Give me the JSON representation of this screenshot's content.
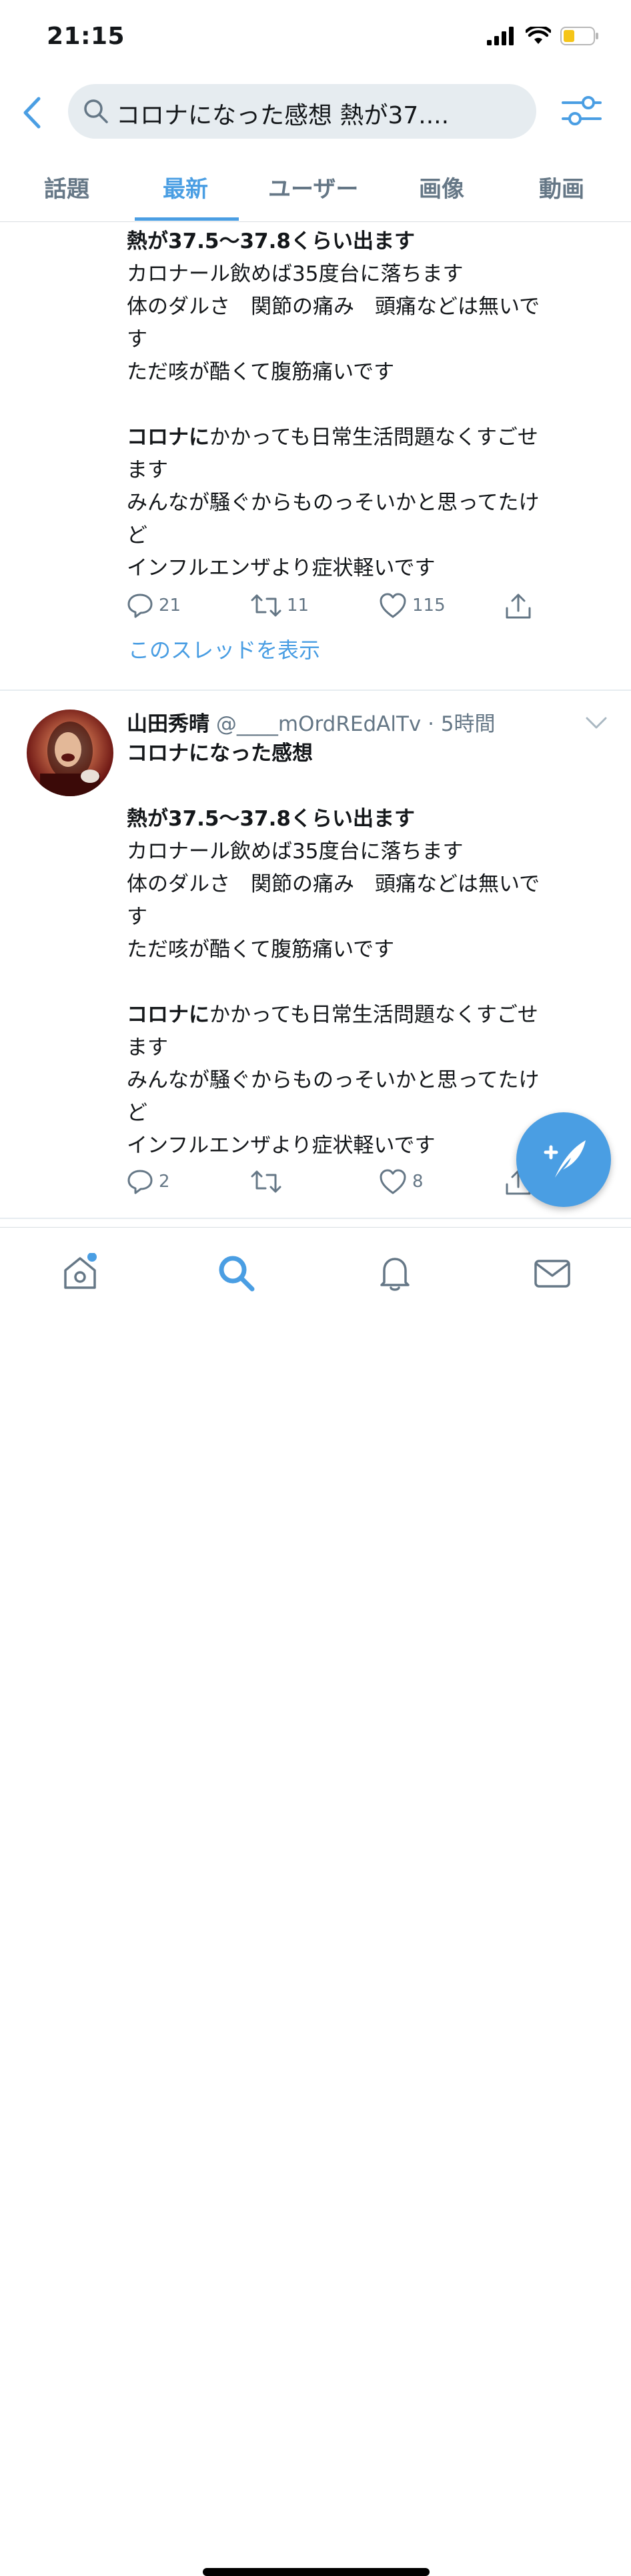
{
  "status_bar": {
    "time": "21:15"
  },
  "search": {
    "query": "コロナになった感想 熱が37...."
  },
  "tabs": [
    {
      "label": "話題",
      "active": false
    },
    {
      "label": "最新",
      "active": true
    },
    {
      "label": "ユーザー",
      "active": false
    },
    {
      "label": "画像",
      "active": false
    },
    {
      "label": "動画",
      "active": false
    }
  ],
  "tweet1": {
    "lines": [
      "<b>熱が37.5〜37.8くらい出ます</b>",
      "カロナール飲めば35度台に落ちます",
      "体のダルさ　関節の痛み　頭痛などは無いで",
      "す",
      "ただ咳が酷くて腹筋痛いです",
      "",
      "<b>コロナに</b>かかっても日常生活問題なくすごせ",
      "ます",
      "みんなが騒ぐからものっそいかと思ってたけ",
      "ど",
      "インフルエンザより症状軽いです"
    ],
    "replies": "21",
    "retweets": "11",
    "likes": "115",
    "show_thread": "このスレッドを表示"
  },
  "tweet2": {
    "name": "山田秀晴",
    "handle": "@____mOrdREdAlTv",
    "separator": "·",
    "time": "5時間",
    "lines": [
      "<b>コロナになった感想</b>",
      "",
      "<b>熱が37.5〜37.8くらい出ます</b>",
      "カロナール飲めば35度台に落ちます",
      "体のダルさ　関節の痛み　頭痛などは無いで",
      "す",
      "ただ咳が酷くて腹筋痛いです",
      "",
      "<b>コロナに</b>かかっても日常生活問題なくすごせ",
      "ます",
      "みんなが騒ぐからものっそいかと思ってたけ",
      "ど",
      "インフルエンザより症状軽いです"
    ],
    "replies": "2",
    "retweets": "",
    "likes": "8"
  },
  "colors": {
    "accent": "#4a9ee3",
    "muted": "#657786",
    "text": "#14171a",
    "battery_fill": "#f5c518"
  },
  "icons": [
    "back-chevron-icon",
    "search-icon",
    "filter-icon",
    "reply-icon",
    "retweet-icon",
    "like-icon",
    "share-icon",
    "chevron-down-icon",
    "compose-icon",
    "home-icon",
    "search-tab-icon",
    "notifications-icon",
    "messages-icon"
  ]
}
